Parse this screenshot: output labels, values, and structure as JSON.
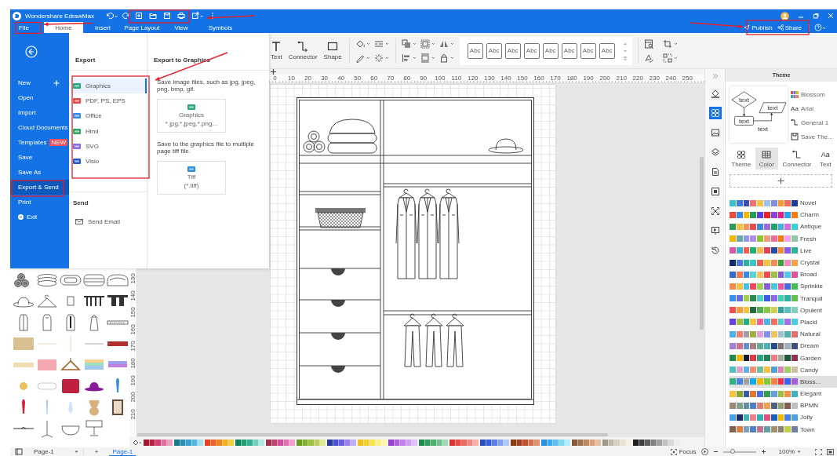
{
  "title_bar": {
    "app_name": "Wondershare EdrawMax"
  },
  "menu_tabs": [
    {
      "label": "File",
      "selected": false
    },
    {
      "label": "Home",
      "selected": true
    },
    {
      "label": "Insert",
      "selected": false
    },
    {
      "label": "Page Layout",
      "selected": false
    },
    {
      "label": "View",
      "selected": false
    },
    {
      "label": "Symbols",
      "selected": false
    }
  ],
  "header_actions": {
    "publish": "Publish",
    "share": "Share"
  },
  "ribbon": {
    "tools": [
      {
        "label": "Text",
        "kind": "text"
      },
      {
        "label": "Connector",
        "kind": "connector"
      },
      {
        "label": "Shape",
        "kind": "shape"
      }
    ],
    "styles": [
      "Abc",
      "Abc",
      "Abc",
      "Abc",
      "Abc",
      "Abc",
      "Abc",
      "Abc"
    ]
  },
  "ruler": {
    "horizontal": [
      "0",
      "10",
      "20",
      "30",
      "40",
      "50",
      "60",
      "70",
      "80",
      "90",
      "100",
      "110",
      "120",
      "130",
      "140",
      "150",
      "160",
      "170",
      "180",
      "190",
      "200",
      "210",
      "220",
      "230",
      "240",
      "250"
    ],
    "vertical": [
      "130",
      "140",
      "150",
      "160",
      "170",
      "180",
      "190",
      "200",
      "210"
    ]
  },
  "file_menu": {
    "nav": [
      {
        "label": "New",
        "kind": "new",
        "selected": false
      },
      {
        "label": "Open",
        "kind": "item",
        "selected": false
      },
      {
        "label": "Import",
        "kind": "item",
        "selected": false
      },
      {
        "label": "Cloud Documents",
        "kind": "item",
        "selected": false
      },
      {
        "label": "Templates",
        "kind": "item",
        "selected": false,
        "badge": "NEW"
      },
      {
        "label": "Save",
        "kind": "item",
        "selected": false
      },
      {
        "label": "Save As",
        "kind": "item",
        "selected": false
      },
      {
        "label": "Export & Send",
        "kind": "item",
        "selected": true
      },
      {
        "label": "Print",
        "kind": "item",
        "selected": false
      },
      {
        "label": "Exit",
        "kind": "exit",
        "selected": false
      }
    ],
    "export": {
      "title": "Export",
      "formats": [
        {
          "label": "Graphics",
          "selected": true,
          "color": "#2aa876"
        },
        {
          "label": "PDF, PS, EPS",
          "selected": false,
          "color": "#e84a4a"
        },
        {
          "label": "Office",
          "selected": false,
          "color": "#3a8ae8"
        },
        {
          "label": "Html",
          "selected": false,
          "color": "#30a860"
        },
        {
          "label": "SVG",
          "selected": false,
          "color": "#8a6ae0"
        },
        {
          "label": "Visio",
          "selected": false,
          "color": "#2a5ac8"
        }
      ]
    },
    "send": {
      "title": "Send",
      "items": [
        "Send Email"
      ]
    },
    "detail": {
      "title": "Export to Graphics",
      "sections": [
        {
          "description": "Save image files, such as jpg, jpeg, png, bmp, gif.",
          "card_title": "Graphics",
          "card_subtitle": "*.jpg,*.jpeg,*.png..."
        },
        {
          "description": "Save to the graphics file to multiple page tiff file.",
          "card_title": "Tiff",
          "card_subtitle": "(*.tiff)"
        }
      ]
    }
  },
  "side_tools": [
    {
      "kind": "fill",
      "selected": false
    },
    {
      "kind": "theme",
      "selected": true
    },
    {
      "kind": "image",
      "selected": false
    },
    {
      "kind": "layers",
      "selected": false
    },
    {
      "kind": "page",
      "selected": false
    },
    {
      "kind": "fit",
      "selected": false
    },
    {
      "kind": "expand",
      "selected": false
    },
    {
      "kind": "present",
      "selected": false
    },
    {
      "kind": "history",
      "selected": false
    }
  ],
  "theme_panel": {
    "title": "Theme",
    "preview_labels": [
      "text",
      "text",
      "text",
      "text"
    ],
    "properties": [
      {
        "label": "Blossom",
        "kind": "palette"
      },
      {
        "label": "Arial",
        "kind": "font",
        "glyph": "Aa"
      },
      {
        "label": "General 1",
        "kind": "connector"
      },
      {
        "label": "Save The...",
        "kind": "save"
      }
    ],
    "tabs": [
      {
        "label": "Theme",
        "kind": "theme",
        "selected": false
      },
      {
        "label": "Color",
        "kind": "color",
        "selected": true
      },
      {
        "label": "Connector",
        "kind": "connector",
        "selected": false
      },
      {
        "label": "Text",
        "kind": "text",
        "selected": false,
        "glyph": "Aa"
      }
    ],
    "themes": [
      {
        "name": "Novel",
        "selected": false,
        "swatches": [
          {
            "color": "#3cc3c8"
          },
          {
            "color": "#3d7be0"
          },
          {
            "color": "#3b4fb5"
          },
          {
            "color": "#f07070"
          },
          {
            "color": "#f5c242"
          },
          {
            "color": "#9cc0f0"
          },
          {
            "color": "#7f8de8"
          },
          {
            "color": "#f59b2b"
          },
          {
            "color": "#f26b5b"
          },
          {
            "color": "#1d3d9e"
          }
        ]
      },
      {
        "name": "Charm",
        "selected": false,
        "swatches": [
          {
            "color": "#f04a3a"
          },
          {
            "color": "#3f86e8"
          },
          {
            "color": "#f5b800"
          },
          {
            "color": "#22a055"
          },
          {
            "color": "#5a3de0"
          },
          {
            "color": "#e8202a"
          },
          {
            "color": "#8e3fd6"
          },
          {
            "color": "#e0208a"
          },
          {
            "color": "#2fa4e8"
          },
          {
            "color": "#f57a10"
          }
        ]
      },
      {
        "name": "Antique",
        "selected": false,
        "swatches": [
          {
            "color": "#2f9a5a"
          },
          {
            "color": "#f5c242"
          },
          {
            "color": "#f5955a"
          },
          {
            "color": "#e05050"
          },
          {
            "color": "#3a8ae0"
          },
          {
            "color": "#a06ad8"
          },
          {
            "color": "#23a06a"
          },
          {
            "color": "#48b0e0"
          },
          {
            "color": "#d070e0"
          },
          {
            "color": "#3bd0d8"
          }
        ]
      },
      {
        "name": "Fresh",
        "selected": false,
        "swatches": [
          {
            "color": "#f5b800"
          },
          {
            "color": "#6aa8a0"
          },
          {
            "color": "#8a9ae8"
          },
          {
            "color": "#b48ae8"
          },
          {
            "color": "#8ac830"
          },
          {
            "color": "#f59b7a"
          },
          {
            "color": "#f06a9a"
          },
          {
            "color": "#f57a10"
          },
          {
            "color": "#f5a0e8"
          },
          {
            "color": "#90c8a0"
          }
        ]
      },
      {
        "name": "Live",
        "selected": false,
        "swatches": [
          {
            "color": "#d858a8"
          },
          {
            "color": "#3ab0d8"
          },
          {
            "color": "#f06050"
          },
          {
            "color": "#20b070"
          },
          {
            "color": "#f5b84a"
          },
          {
            "color": "#e04060"
          },
          {
            "color": "#2a4aa0"
          },
          {
            "color": "#f58a30"
          },
          {
            "color": "#8a5ae8"
          },
          {
            "color": "#30b0a0"
          }
        ]
      },
      {
        "name": "Crystal",
        "selected": false,
        "swatches": [
          {
            "color": "#1a2a6a"
          },
          {
            "color": "#4a7ae8"
          },
          {
            "color": "#30b0a0"
          },
          {
            "color": "#38c8c8"
          },
          {
            "color": "#f06050"
          },
          {
            "color": "#f5c242"
          },
          {
            "color": "#f58a50"
          },
          {
            "color": "#3aa040"
          },
          {
            "color": "#f08ac0"
          },
          {
            "color": "#f5a04a"
          }
        ]
      },
      {
        "name": "Broad",
        "selected": false,
        "swatches": [
          {
            "color": "#3a6ac8"
          },
          {
            "color": "#f57a50"
          },
          {
            "color": "#3a8ae8"
          },
          {
            "color": "#5ad0d0"
          },
          {
            "color": "#f5c060"
          },
          {
            "color": "#f04a50"
          },
          {
            "color": "#a0c040"
          },
          {
            "color": "#8a5ad8"
          },
          {
            "color": "#50c8e8"
          },
          {
            "color": "#e050a0"
          }
        ]
      },
      {
        "name": "Sprinkle",
        "selected": false,
        "swatches": [
          {
            "color": "#f58a50"
          },
          {
            "color": "#f5c242"
          },
          {
            "color": "#4ac0e0"
          },
          {
            "color": "#f04a60"
          },
          {
            "color": "#a0d050"
          },
          {
            "color": "#8a5ad8"
          },
          {
            "color": "#40c8e0"
          },
          {
            "color": "#f050a0"
          },
          {
            "color": "#4a6ae0"
          },
          {
            "color": "#40c050"
          }
        ]
      },
      {
        "name": "Tranquil",
        "selected": false,
        "swatches": [
          {
            "color": "#3a90e8"
          },
          {
            "color": "#6a6ae0"
          },
          {
            "color": "#a0d050"
          },
          {
            "color": "#2a8a50"
          },
          {
            "color": "#50d0c0"
          },
          {
            "color": "#3a5ae8"
          },
          {
            "color": "#8a6ae8"
          },
          {
            "color": "#40d0b0"
          },
          {
            "color": "#30b0a0"
          },
          {
            "color": "#60c050"
          }
        ]
      },
      {
        "name": "Opulent",
        "selected": false,
        "swatches": [
          {
            "color": "#f05050"
          },
          {
            "color": "#f5a040"
          },
          {
            "color": "#f5c242"
          },
          {
            "color": "#206a40"
          },
          {
            "color": "#50b050"
          },
          {
            "color": "#8ac840"
          },
          {
            "color": "#d0d050"
          },
          {
            "color": "#30a0a0"
          },
          {
            "color": "#60c0c0"
          },
          {
            "color": "#80d0c0"
          }
        ]
      },
      {
        "name": "Placid",
        "selected": false,
        "swatches": [
          {
            "color": "#6a40e0"
          },
          {
            "color": "#a0c040"
          },
          {
            "color": "#20b080"
          },
          {
            "color": "#f5c242"
          },
          {
            "color": "#f06090"
          },
          {
            "color": "#50b0e8"
          },
          {
            "color": "#f07060"
          },
          {
            "color": "#50d0d0"
          },
          {
            "color": "#a070e8"
          },
          {
            "color": "#50c8e8"
          }
        ]
      },
      {
        "name": "Natural",
        "selected": false,
        "swatches": [
          {
            "color": "#50b0e8"
          },
          {
            "color": "#f08070"
          },
          {
            "color": "#a0a0a0"
          },
          {
            "color": "#a0b040"
          },
          {
            "color": "#e0a0e0"
          },
          {
            "color": "#8090e8"
          },
          {
            "color": "#f5c060"
          },
          {
            "color": "#a0c0d0"
          },
          {
            "color": "#50b0b0"
          },
          {
            "color": "#e07070"
          }
        ]
      },
      {
        "name": "Dream",
        "selected": false,
        "swatches": [
          {
            "color": "#a080d0"
          },
          {
            "color": "#d07090"
          },
          {
            "color": "#6a90c8"
          },
          {
            "color": "#a08080"
          },
          {
            "color": "#60b090"
          },
          {
            "color": "#50b0b8"
          },
          {
            "color": "#2a4a90"
          },
          {
            "color": "#807070"
          },
          {
            "color": "#a0b0c0"
          },
          {
            "color": "#3a5080"
          }
        ]
      },
      {
        "name": "Garden",
        "selected": false,
        "swatches": [
          {
            "color": "#208a50"
          },
          {
            "color": "#f5b800"
          },
          {
            "color": "#1a1a2a"
          },
          {
            "color": "#e03a4a"
          },
          {
            "color": "#30a080"
          },
          {
            "color": "#208060"
          },
          {
            "color": "#f08080"
          },
          {
            "color": "#a0b0a0"
          },
          {
            "color": "#205a3a"
          },
          {
            "color": "#903050"
          }
        ]
      },
      {
        "name": "Candy",
        "selected": false,
        "swatches": [
          {
            "color": "#50c0c0"
          },
          {
            "color": "#e0a0d0"
          },
          {
            "color": "#60b0e8"
          },
          {
            "color": "#f09070"
          },
          {
            "color": "#70c0a0"
          },
          {
            "color": "#f5c242"
          },
          {
            "color": "#50a0d0"
          },
          {
            "color": "#e080b0"
          },
          {
            "color": "#a0d060"
          },
          {
            "color": "#d0c0a0"
          }
        ]
      },
      {
        "name": "Bloss...",
        "selected": true,
        "swatches": [
          {
            "color": "#30b080"
          },
          {
            "color": "#4a80e0"
          },
          {
            "color": "#a0a0a0"
          },
          {
            "color": "#10a8e8"
          },
          {
            "color": "#f5b800"
          },
          {
            "color": "#80c840"
          },
          {
            "color": "#f58040"
          },
          {
            "color": "#f03050"
          },
          {
            "color": "#3a60e8"
          },
          {
            "color": "#a060e0"
          }
        ]
      },
      {
        "name": "Elegant",
        "selected": false,
        "swatches": [
          {
            "color": "#f5c242"
          },
          {
            "color": "#8aa830"
          },
          {
            "color": "#3a5aa0"
          },
          {
            "color": "#e07a30"
          },
          {
            "color": "#4a70e0"
          },
          {
            "color": "#30a050"
          },
          {
            "color": "#60a0e0"
          },
          {
            "color": "#a0c040"
          },
          {
            "color": "#f59050"
          },
          {
            "color": "#40b0c0"
          }
        ]
      },
      {
        "name": "BPMN",
        "selected": false,
        "swatches": [
          {
            "color": "#a08878"
          },
          {
            "color": "#80a090"
          },
          {
            "color": "#6090a0"
          },
          {
            "color": "#5080c0"
          },
          {
            "color": "#e08070"
          },
          {
            "color": "#f0a050"
          },
          {
            "color": "#506080"
          },
          {
            "color": "#90a070"
          },
          {
            "color": "#806050"
          },
          {
            "color": "#c0c0c0"
          }
        ]
      },
      {
        "name": "Jolly",
        "selected": false,
        "swatches": [
          {
            "color": "#4aa0e8"
          },
          {
            "color": "#1a2a6a"
          },
          {
            "color": "#40b0b0"
          },
          {
            "color": "#f08090"
          },
          {
            "color": "#30b0b0"
          },
          {
            "color": "#e05080"
          },
          {
            "color": "#1a60c0"
          },
          {
            "color": "#f5b800"
          },
          {
            "color": "#4a80e0"
          },
          {
            "color": "#50a0e0"
          }
        ]
      },
      {
        "name": "Town",
        "selected": false,
        "swatches": [
          {
            "color": "#806050"
          },
          {
            "color": "#e08040"
          },
          {
            "color": "#80a0c0"
          },
          {
            "color": "#5080c0"
          },
          {
            "color": "#c07090"
          },
          {
            "color": "#60a0a0"
          },
          {
            "color": "#a09070"
          },
          {
            "color": "#908070"
          },
          {
            "color": "#c0d040"
          },
          {
            "color": "#7080a0"
          }
        ]
      }
    ]
  },
  "status_bar": {
    "page_select": "Page-1",
    "add_page": "+",
    "page_tab": "Page-1",
    "focus": "Focus",
    "zoom": "100%",
    "zoom_slider": {
      "level": 0.3
    }
  }
}
